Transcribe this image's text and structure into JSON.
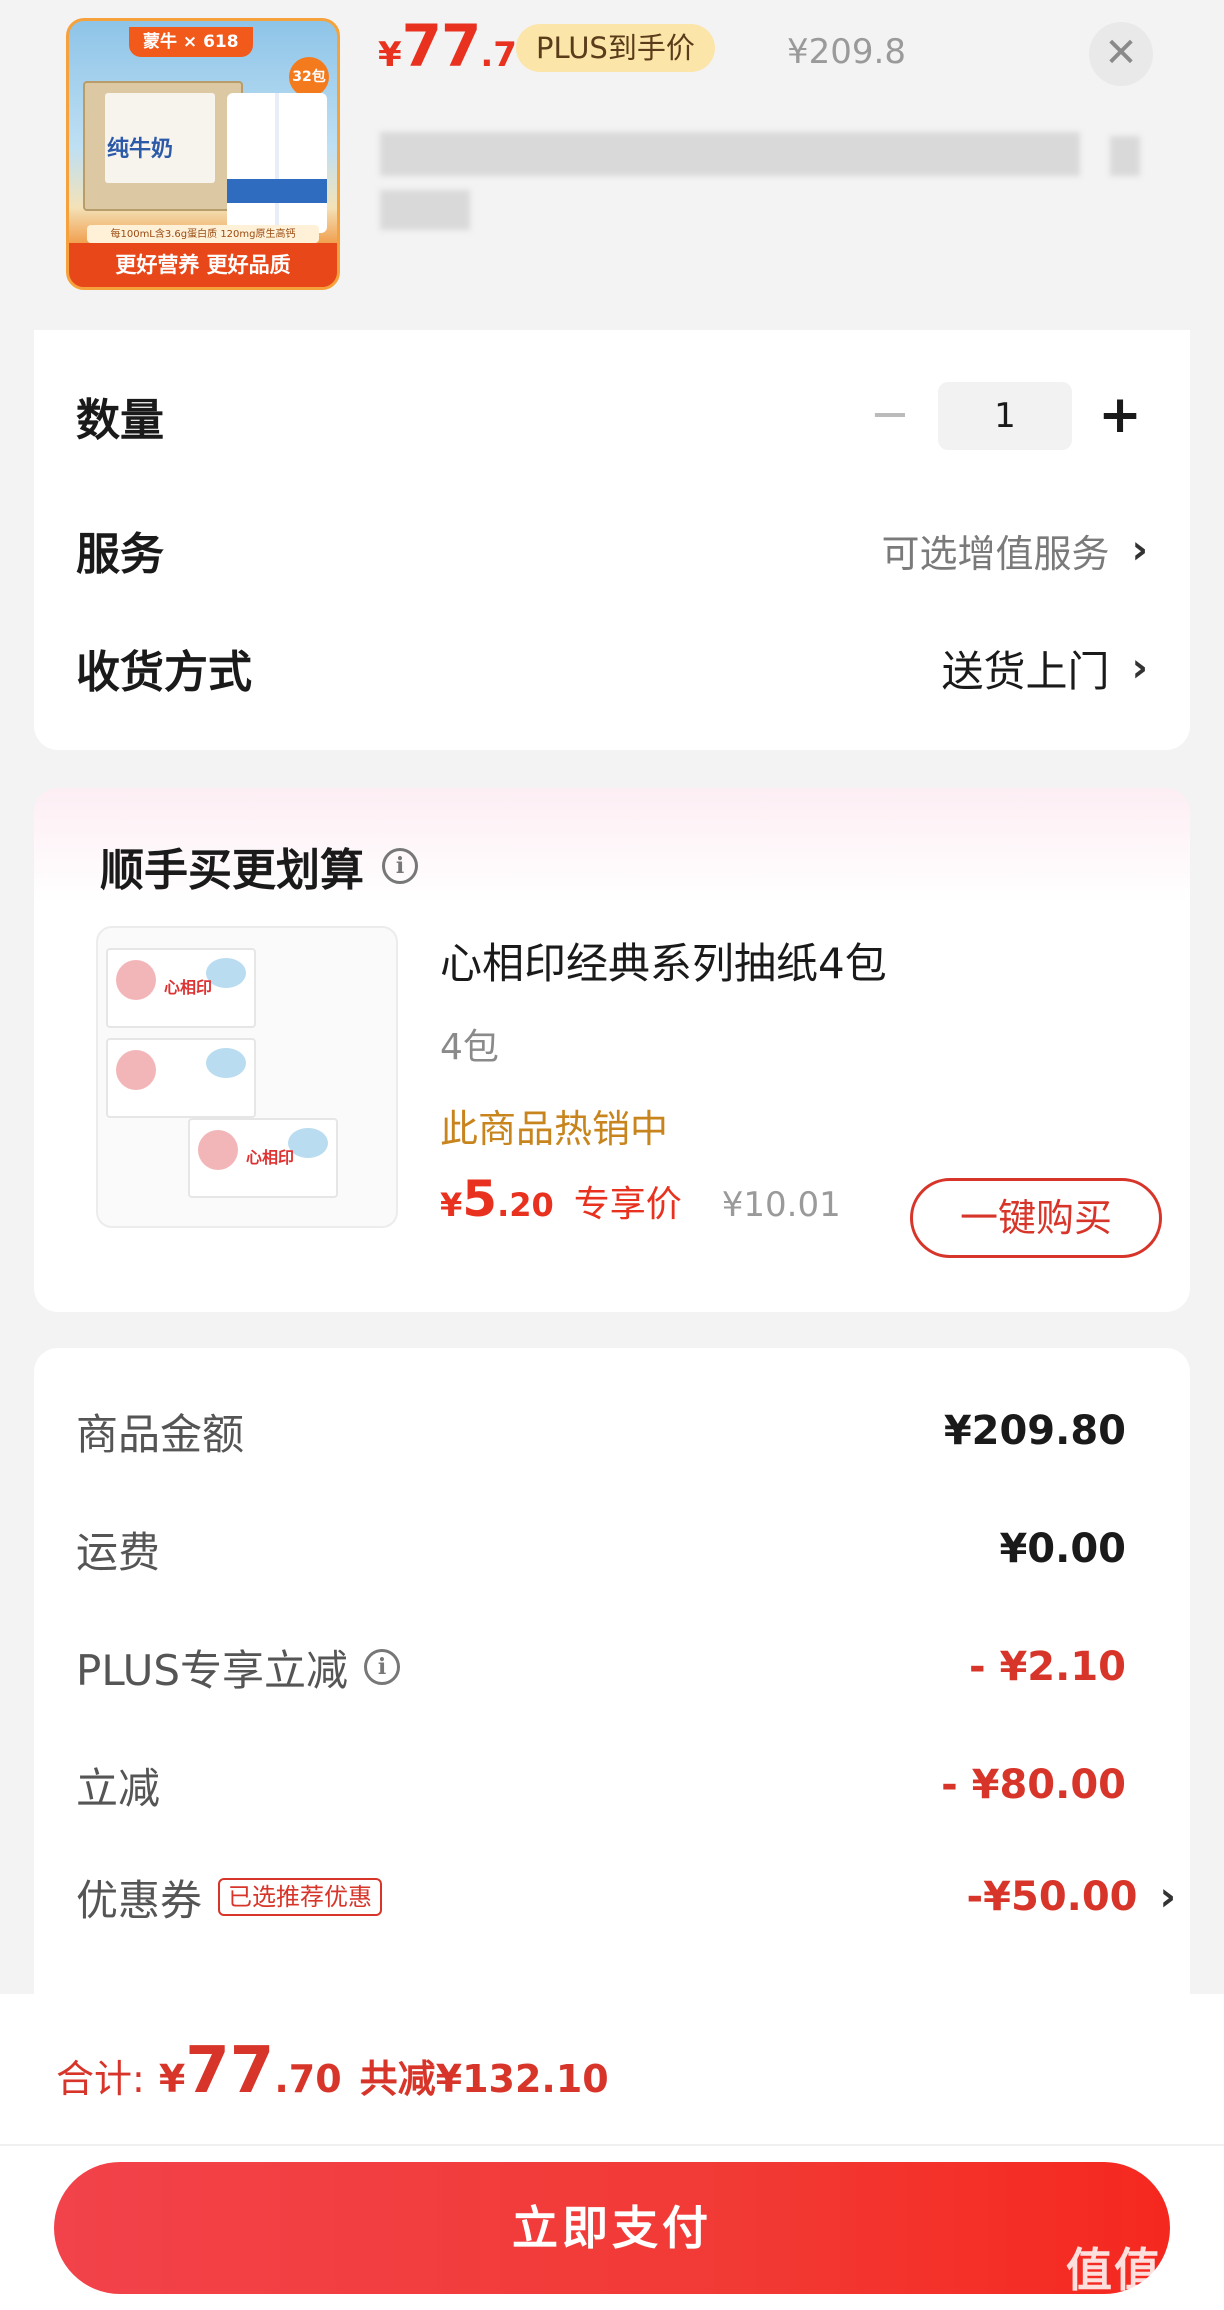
{
  "product": {
    "thumb": {
      "brand_pill": "蒙牛 × 618",
      "pack_badge": "32包",
      "box_label": "纯牛奶",
      "tag": "每100mL含3.6g蛋白质 120mg原生高钙",
      "slogan": "更好营养 更好品质"
    },
    "price_currency": "¥",
    "price_int": "77",
    "price_dec": ".7",
    "plus_label": "PLUS到手价",
    "original_price": "¥209.8",
    "close_icon": "close-icon"
  },
  "options": {
    "quantity_label": "数量",
    "quantity_minus": "−",
    "quantity_value": "1",
    "quantity_plus": "+",
    "service_label": "服务",
    "service_value": "可选增值服务",
    "delivery_label": "收货方式",
    "delivery_value": "送货上门",
    "chevron": "›"
  },
  "addon": {
    "title": "顺手买更划算",
    "info": "i",
    "image_logo": "心相印",
    "name": "心相印经典系列抽纸4包",
    "spec": "4包",
    "hot": "此商品热销中",
    "price_currency": "¥",
    "price_int": "5",
    "price_dec": ".20",
    "price_tag": "专享价",
    "original_price": "¥10.01",
    "buy_label": "一键购买"
  },
  "summary": {
    "goods_label": "商品金额",
    "goods_value": "¥209.80",
    "shipping_label": "运费",
    "shipping_value": "¥0.00",
    "plus_label": "PLUS专享立减",
    "plus_value": "- ¥2.10",
    "discount_label": "立减",
    "discount_value": "- ¥80.00",
    "coupon_label": "优惠券",
    "coupon_badge": "已选推荐优惠",
    "coupon_value": "-¥50.00"
  },
  "footer": {
    "total_label": "合计:",
    "total_currency": "¥",
    "total_int": "77",
    "total_dec": ".70",
    "saved": "共减¥132.10",
    "pay_label": "立即支付",
    "watermark": "值值值",
    "watermark_url": "zhizhizhi.com"
  },
  "colors": {
    "accent_red": "#e8321f",
    "gold": "#c8851e",
    "plus_pill_bg": "#fbe5a8"
  }
}
